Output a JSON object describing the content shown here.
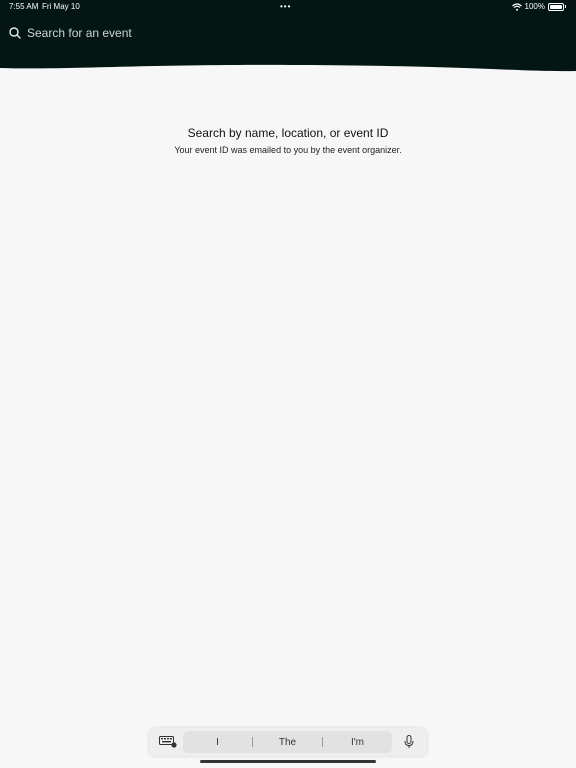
{
  "status_bar": {
    "time": "7:55 AM",
    "date": "Fri May 10",
    "dots": "•••",
    "battery": "100%"
  },
  "search": {
    "placeholder": "Search for an event",
    "value": ""
  },
  "empty_state": {
    "title": "Search by name, location, or event ID",
    "subtitle": "Your event ID was emailed to you by the event organizer."
  },
  "keyboard": {
    "suggestions": [
      "I",
      "The",
      "I'm"
    ]
  },
  "colors": {
    "header_bg": "#031613",
    "page_bg": "#f7f7f7"
  },
  "icons": {
    "search": "search-icon",
    "wifi": "wifi-icon",
    "battery": "battery-icon",
    "keyboard": "keyboard-icon",
    "mic": "mic-icon"
  }
}
